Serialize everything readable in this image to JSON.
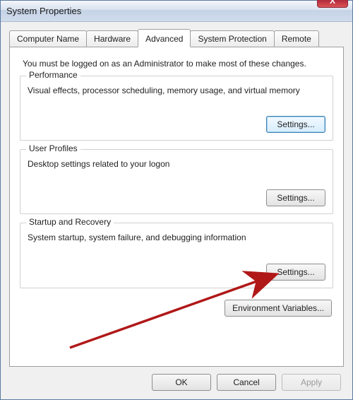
{
  "window": {
    "title": "System Properties"
  },
  "tabs": [
    {
      "label": "Computer Name"
    },
    {
      "label": "Hardware"
    },
    {
      "label": "Advanced"
    },
    {
      "label": "System Protection"
    },
    {
      "label": "Remote"
    }
  ],
  "intro": "You must be logged on as an Administrator to make most of these changes.",
  "groups": {
    "performance": {
      "legend": "Performance",
      "desc": "Visual effects, processor scheduling, memory usage, and virtual memory",
      "button": "Settings..."
    },
    "user_profiles": {
      "legend": "User Profiles",
      "desc": "Desktop settings related to your logon",
      "button": "Settings..."
    },
    "startup": {
      "legend": "Startup and Recovery",
      "desc": "System startup, system failure, and debugging information",
      "button": "Settings..."
    }
  },
  "env_button": "Environment Variables...",
  "footer": {
    "ok": "OK",
    "cancel": "Cancel",
    "apply": "Apply"
  },
  "close_glyph": "X"
}
